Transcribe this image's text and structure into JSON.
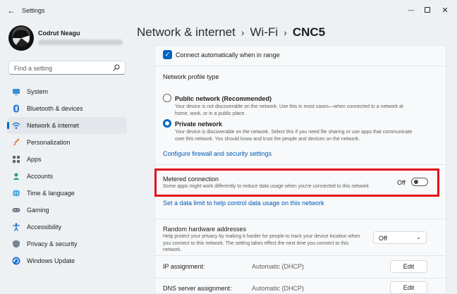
{
  "window": {
    "title": "Settings",
    "back_glyph": "←",
    "minimize_glyph": "—",
    "close_glyph": "✕"
  },
  "user": {
    "name": "Codrut Neagu"
  },
  "search": {
    "placeholder": "Find a setting"
  },
  "sidebar": {
    "items": [
      {
        "label": "System",
        "icon": "system-icon",
        "active": false
      },
      {
        "label": "Bluetooth & devices",
        "icon": "bluetooth-icon",
        "active": false
      },
      {
        "label": "Network & internet",
        "icon": "wifi-icon",
        "active": true
      },
      {
        "label": "Personalization",
        "icon": "brush-icon",
        "active": false
      },
      {
        "label": "Apps",
        "icon": "apps-icon",
        "active": false
      },
      {
        "label": "Accounts",
        "icon": "accounts-icon",
        "active": false
      },
      {
        "label": "Time & language",
        "icon": "globe-icon",
        "active": false
      },
      {
        "label": "Gaming",
        "icon": "gamepad-icon",
        "active": false
      },
      {
        "label": "Accessibility",
        "icon": "accessibility-icon",
        "active": false
      },
      {
        "label": "Privacy & security",
        "icon": "shield-icon",
        "active": false
      },
      {
        "label": "Windows Update",
        "icon": "update-icon",
        "active": false
      }
    ]
  },
  "breadcrumb": {
    "part1": "Network & internet",
    "sep": "›",
    "part2": "Wi-Fi",
    "current": "CNC5"
  },
  "main": {
    "connect_auto": {
      "label": "Connect automatically when in range",
      "checked": true
    },
    "profile_type_label": "Network profile type",
    "public_network": {
      "title": "Public network (Recommended)",
      "desc": "Your device is not discoverable on the network. Use this in most cases—when connected to a network at home, work, or in a public place.",
      "selected": false
    },
    "private_network": {
      "title": "Private network",
      "desc": "Your device is discoverable on the network. Select this if you need file sharing or use apps that communicate over this network. You should know and trust the people and devices on the network.",
      "selected": true
    },
    "firewall_link": "Configure firewall and security settings",
    "metered": {
      "title": "Metered connection",
      "desc": "Some apps might work differently to reduce data usage when you're connected to this network",
      "toggle_label": "Off",
      "on": false
    },
    "data_limit_link": "Set a data limit to help control data usage on this network",
    "random_hw": {
      "title": "Random hardware addresses",
      "desc": "Help protect your privacy by making it harder for people to track your device location when you connect to this network. The setting takes effect the next time you connect to this network.",
      "value": "Off",
      "chevron": "⌄"
    },
    "ip_assignment": {
      "label": "IP assignment:",
      "value": "Automatic (DHCP)",
      "button": "Edit"
    },
    "dns_assignment": {
      "label": "DNS server assignment:",
      "value": "Automatic (DHCP)",
      "button": "Edit"
    }
  },
  "colors": {
    "accent": "#0067c0",
    "highlight_border": "#e3101a"
  }
}
